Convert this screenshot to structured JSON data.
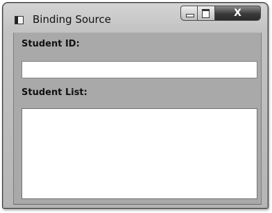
{
  "window": {
    "title": "Binding Source",
    "close_label": "X"
  },
  "form": {
    "student_id_label": "Student ID:",
    "student_id_value": "",
    "student_list_label": "Student List:",
    "student_list_items": []
  }
}
